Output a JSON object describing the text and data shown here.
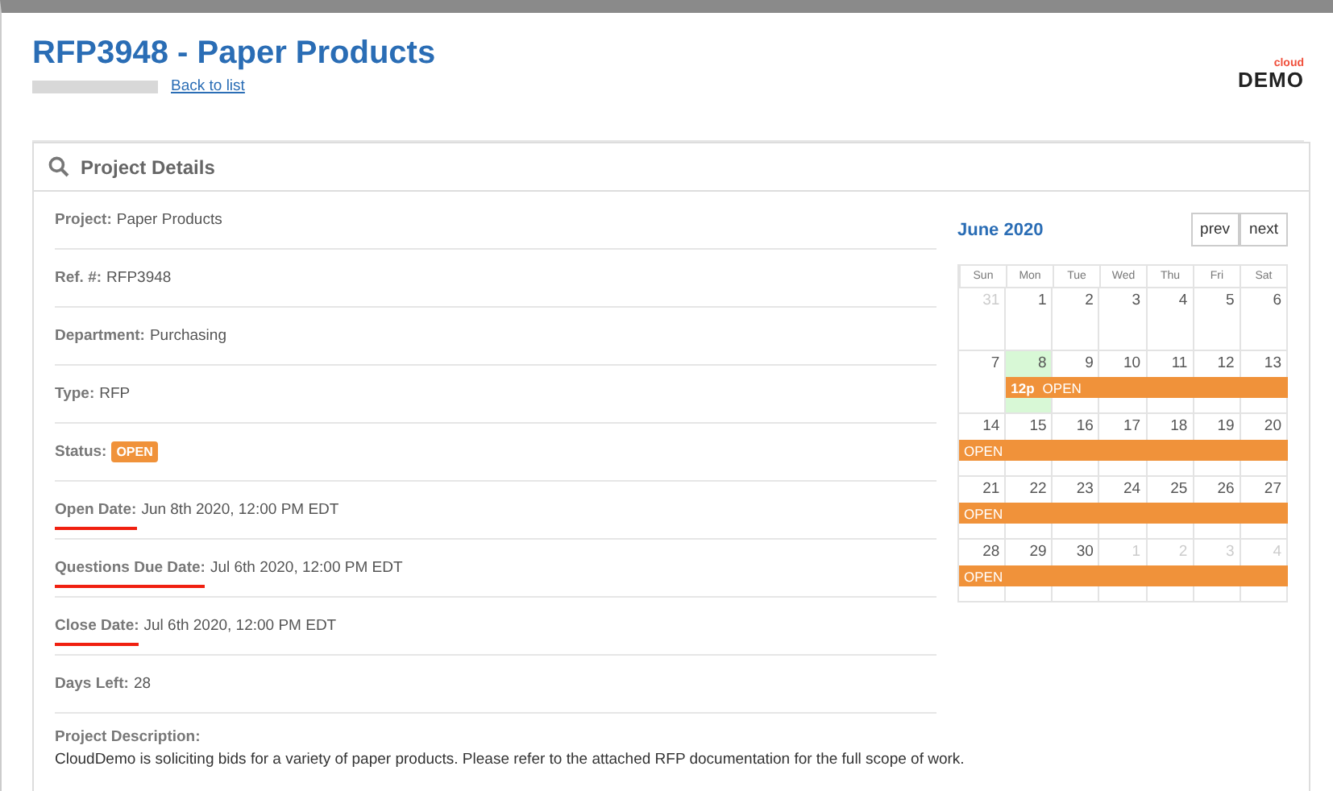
{
  "header": {
    "title": "RFP3948 - Paper Products",
    "back_link": "Back to list",
    "logo": {
      "top": "cloud",
      "bottom": "DEMO"
    }
  },
  "panel": {
    "title": "Project Details",
    "fields": [
      {
        "label": "Project:",
        "value": "Paper Products",
        "kind": "text",
        "underlined": false
      },
      {
        "label": "Ref. #:",
        "value": "RFP3948",
        "kind": "text",
        "underlined": false
      },
      {
        "label": "Department:",
        "value": "Purchasing",
        "kind": "text",
        "underlined": false
      },
      {
        "label": "Type:",
        "value": "RFP",
        "kind": "text",
        "underlined": false
      },
      {
        "label": "Status:",
        "value": "OPEN",
        "kind": "badge",
        "underlined": false
      },
      {
        "label": "Open Date:",
        "value": "Jun 8th 2020, 12:00 PM EDT",
        "kind": "text",
        "underlined": true
      },
      {
        "label": "Questions Due Date:",
        "value": "Jul 6th 2020, 12:00 PM EDT",
        "kind": "text",
        "underlined": true
      },
      {
        "label": "Close Date:",
        "value": "Jul 6th 2020, 12:00 PM EDT",
        "kind": "text",
        "underlined": true
      },
      {
        "label": "Days Left:",
        "value": "28",
        "kind": "text",
        "underlined": false
      },
      {
        "label": "Project Description:",
        "value": "CloudDemo is soliciting bids for a variety of paper products. Please refer to the attached RFP documentation for the full scope of work.",
        "kind": "block",
        "underlined": false
      }
    ],
    "calendar": {
      "month": "June 2020",
      "buttons": [
        "prev",
        "next"
      ],
      "weekdays": [
        "Sun",
        "Mon",
        "Tue",
        "Wed",
        "Thu",
        "Fri",
        "Sat"
      ],
      "weeks": [
        {
          "days": [
            {
              "n": "31",
              "muted": true,
              "today": false
            },
            {
              "n": "1",
              "muted": false,
              "today": false
            },
            {
              "n": "2",
              "muted": false,
              "today": false
            },
            {
              "n": "3",
              "muted": false,
              "today": false
            },
            {
              "n": "4",
              "muted": false,
              "today": false
            },
            {
              "n": "5",
              "muted": false,
              "today": false
            },
            {
              "n": "6",
              "muted": false,
              "today": false
            }
          ]
        },
        {
          "days": [
            {
              "n": "7",
              "muted": false,
              "today": false
            },
            {
              "n": "8",
              "muted": false,
              "today": true,
              "event_start": true
            },
            {
              "n": "9",
              "muted": false,
              "today": false
            },
            {
              "n": "10",
              "muted": false,
              "today": false
            },
            {
              "n": "11",
              "muted": false,
              "today": false
            },
            {
              "n": "12",
              "muted": false,
              "today": false
            },
            {
              "n": "13",
              "muted": false,
              "today": false
            }
          ],
          "event": {
            "time": "12p",
            "label": "OPEN"
          }
        },
        {
          "days": [
            {
              "n": "14",
              "muted": false,
              "today": false
            },
            {
              "n": "15",
              "muted": false,
              "today": false
            },
            {
              "n": "16",
              "muted": false,
              "today": false
            },
            {
              "n": "17",
              "muted": false,
              "today": false
            },
            {
              "n": "18",
              "muted": false,
              "today": false
            },
            {
              "n": "19",
              "muted": false,
              "today": false
            },
            {
              "n": "20",
              "muted": false,
              "today": false
            }
          ],
          "event": {
            "label": "OPEN"
          }
        },
        {
          "days": [
            {
              "n": "21",
              "muted": false,
              "today": false
            },
            {
              "n": "22",
              "muted": false,
              "today": false
            },
            {
              "n": "23",
              "muted": false,
              "today": false
            },
            {
              "n": "24",
              "muted": false,
              "today": false
            },
            {
              "n": "25",
              "muted": false,
              "today": false
            },
            {
              "n": "26",
              "muted": false,
              "today": false
            },
            {
              "n": "27",
              "muted": false,
              "today": false
            }
          ],
          "event": {
            "label": "OPEN"
          }
        },
        {
          "days": [
            {
              "n": "28",
              "muted": false,
              "today": false
            },
            {
              "n": "29",
              "muted": false,
              "today": false
            },
            {
              "n": "30",
              "muted": false,
              "today": false
            },
            {
              "n": "1",
              "muted": true,
              "today": false
            },
            {
              "n": "2",
              "muted": true,
              "today": false
            },
            {
              "n": "3",
              "muted": true,
              "today": false
            },
            {
              "n": "4",
              "muted": true,
              "today": false
            }
          ],
          "event": {
            "label": "OPEN"
          }
        }
      ]
    }
  }
}
